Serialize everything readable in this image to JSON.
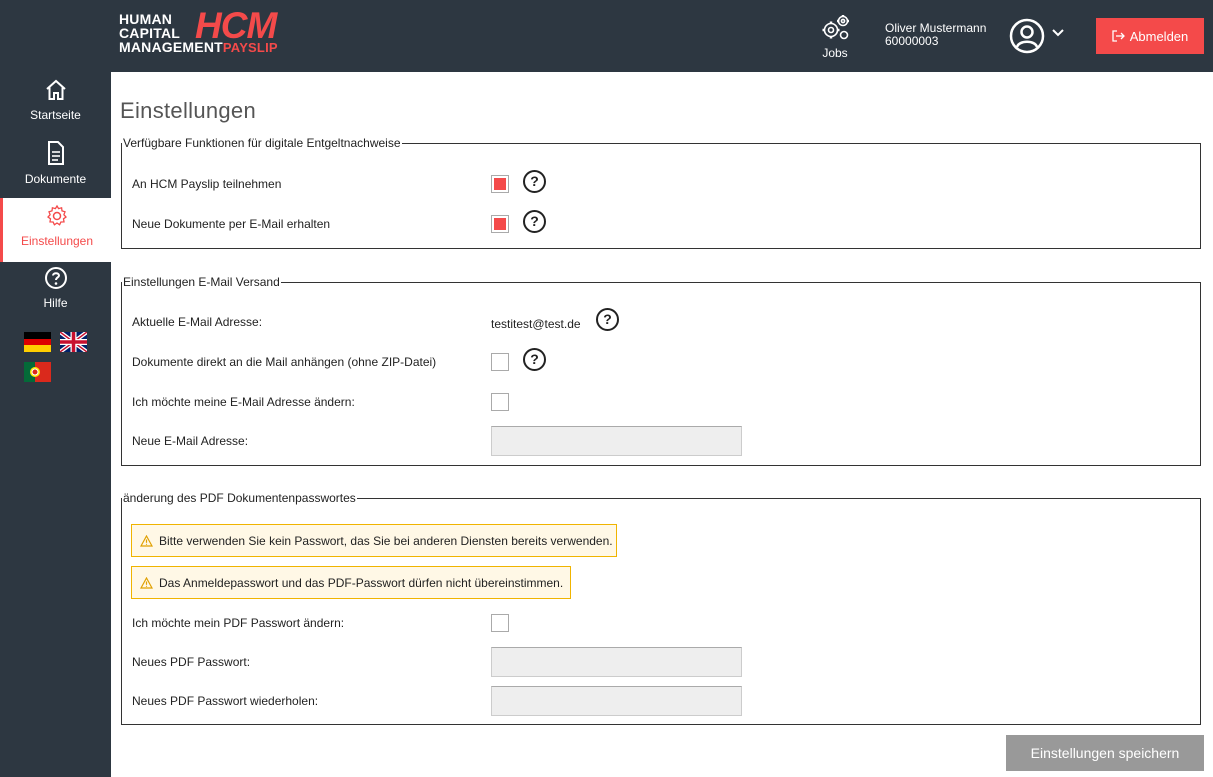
{
  "header": {
    "logo": {
      "line1": "HUMAN",
      "line2": "CAPITAL",
      "line3": "MANAGEMENT",
      "brand": "HCM",
      "sub": "PAYSLIP"
    },
    "jobs_label": "Jobs",
    "user_name": "Oliver Mustermann",
    "user_id": "60000003",
    "logout_label": "Abmelden"
  },
  "sidebar": {
    "items": [
      {
        "label": "Startseite",
        "icon": "home-icon"
      },
      {
        "label": "Dokumente",
        "icon": "document-icon"
      },
      {
        "label": "Einstellungen",
        "icon": "gear-icon",
        "active": true
      },
      {
        "label": "Hilfe",
        "icon": "help-icon"
      }
    ],
    "flags": [
      "flag-de",
      "flag-uk",
      "flag-pt"
    ]
  },
  "page": {
    "title": "Einstellungen",
    "section1": {
      "legend": "Verfügbare Funktionen für digitale Entgeltnachweise",
      "row1_label": "An HCM Payslip teilnehmen",
      "row1_checked": true,
      "row2_label": "Neue Dokumente per E-Mail erhalten",
      "row2_checked": true
    },
    "section2": {
      "legend": "Einstellungen E-Mail Versand",
      "current_email_label": "Aktuelle E-Mail Adresse:",
      "current_email_value": "testitest@test.de",
      "attach_label": "Dokumente direkt an die Mail anhängen (ohne ZIP-Datei)",
      "change_label": "Ich möchte meine E-Mail Adresse ändern:",
      "new_email_label": "Neue E-Mail Adresse:",
      "new_email_value": ""
    },
    "section3": {
      "legend": "änderung des PDF Dokumentenpasswortes",
      "warning1": "Bitte verwenden Sie kein Passwort, das Sie bei anderen Diensten bereits verwenden.",
      "warning2": "Das Anmeldepasswort und das PDF-Passwort dürfen nicht übereinstimmen.",
      "change_label": "Ich möchte mein PDF Passwort ändern:",
      "new_pw_label": "Neues PDF Passwort:",
      "repeat_pw_label": "Neues PDF Passwort wiederholen:"
    },
    "save_label": "Einstellungen speichern",
    "help_glyph": "?"
  },
  "colors": {
    "accent": "#f44a4a",
    "dark": "#2d3741",
    "warning_border": "#f0b400"
  }
}
